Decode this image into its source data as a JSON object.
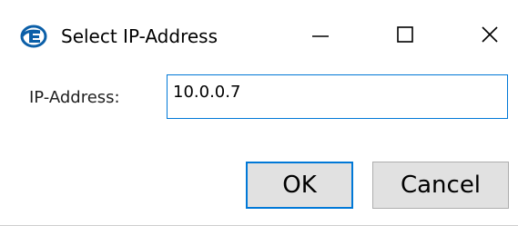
{
  "window": {
    "title": "Select IP-Address",
    "icon": "app-logo-icon",
    "controls": {
      "minimize_icon": "minimize-icon",
      "maximize_icon": "maximize-icon",
      "close_icon": "close-icon"
    }
  },
  "form": {
    "ip_label": "IP-Address:",
    "ip_value": "10.0.0.7"
  },
  "buttons": {
    "ok_label": "OK",
    "cancel_label": "Cancel"
  },
  "colors": {
    "accent": "#0078d7",
    "button_bg": "#e1e1e1",
    "logo": "#0b5fa8"
  }
}
